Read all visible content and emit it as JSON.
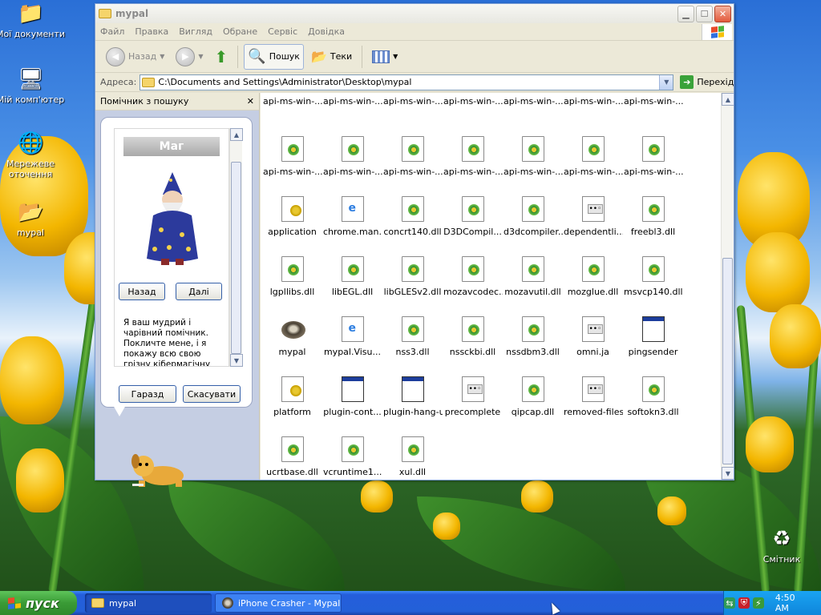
{
  "desktop": {
    "icons": [
      {
        "label": "Мої документи",
        "icon": "my-documents-icon"
      },
      {
        "label": "Мій комп'ютер",
        "icon": "my-computer-icon"
      },
      {
        "label": "Мережеве оточення",
        "icon": "network-places-icon"
      },
      {
        "label": "mypal",
        "icon": "folder-icon"
      },
      {
        "label": "Смітник",
        "icon": "recycle-bin-icon"
      }
    ]
  },
  "window": {
    "title": "mypal",
    "menu": [
      "Файл",
      "Правка",
      "Вигляд",
      "Обране",
      "Сервіс",
      "Довідка"
    ],
    "toolbar": {
      "back": "Назад",
      "search": "Пошук",
      "folders": "Теки"
    },
    "address": {
      "label": "Адреса:",
      "value": "C:\\Documents and Settings\\Administrator\\Desktop\\mypal",
      "go": "Перехід"
    }
  },
  "search_pane": {
    "title": "Помічник з пошуку",
    "character_name": "Маг",
    "back_button": "Назад",
    "next_button": "Далі",
    "description": "Я ваш мудрий і чарівний помічник. Покличте мене, і я покажу всю свою грізну кібермагічну силу",
    "ok_button": "Гаразд",
    "cancel_button": "Скасувати"
  },
  "files": {
    "top_row": [
      "api-ms-win-...",
      "api-ms-win-...",
      "api-ms-win-...",
      "api-ms-win-...",
      "api-ms-win-...",
      "api-ms-win-...",
      "api-ms-win-..."
    ],
    "rows": [
      [
        {
          "name": "api-ms-win-...",
          "type": "dll"
        },
        {
          "name": "api-ms-win-...",
          "type": "dll"
        },
        {
          "name": "api-ms-win-...",
          "type": "dll"
        },
        {
          "name": "api-ms-win-...",
          "type": "dll"
        },
        {
          "name": "api-ms-win-...",
          "type": "dll"
        },
        {
          "name": "api-ms-win-...",
          "type": "dll"
        },
        {
          "name": "api-ms-win-...",
          "type": "dll"
        }
      ],
      [
        {
          "name": "application",
          "type": "cfg"
        },
        {
          "name": "chrome.man...",
          "type": "man"
        },
        {
          "name": "concrt140.dll",
          "type": "dll"
        },
        {
          "name": "D3DCompil...",
          "type": "dll"
        },
        {
          "name": "d3dcompiler...",
          "type": "dll"
        },
        {
          "name": "dependentli...",
          "type": "ja"
        },
        {
          "name": "freebl3.dll",
          "type": "dll"
        }
      ],
      [
        {
          "name": "lgpllibs.dll",
          "type": "dll"
        },
        {
          "name": "libEGL.dll",
          "type": "dll"
        },
        {
          "name": "libGLESv2.dll",
          "type": "dll"
        },
        {
          "name": "mozavcodec...",
          "type": "dll"
        },
        {
          "name": "mozavutil.dll",
          "type": "dll"
        },
        {
          "name": "mozglue.dll",
          "type": "dll"
        },
        {
          "name": "msvcp140.dll",
          "type": "dll"
        }
      ],
      [
        {
          "name": "mypal",
          "type": "raccoon"
        },
        {
          "name": "mypal.Visu...",
          "type": "man"
        },
        {
          "name": "nss3.dll",
          "type": "dll"
        },
        {
          "name": "nssckbi.dll",
          "type": "dll"
        },
        {
          "name": "nssdbm3.dll",
          "type": "dll"
        },
        {
          "name": "omni.ja",
          "type": "ja"
        },
        {
          "name": "pingsender",
          "type": "appw"
        }
      ],
      [
        {
          "name": "platform",
          "type": "cfg"
        },
        {
          "name": "plugin-cont...",
          "type": "appw"
        },
        {
          "name": "plugin-hang-ui",
          "type": "appw"
        },
        {
          "name": "precomplete",
          "type": "ja"
        },
        {
          "name": "qipcap.dll",
          "type": "dll"
        },
        {
          "name": "removed-files",
          "type": "ja"
        },
        {
          "name": "softokn3.dll",
          "type": "dll"
        }
      ],
      [
        {
          "name": "ucrtbase.dll",
          "type": "dll"
        },
        {
          "name": "vcruntime1...",
          "type": "dll"
        },
        {
          "name": "xul.dll",
          "type": "dll"
        }
      ]
    ]
  },
  "taskbar": {
    "start": "пуск",
    "tasks": [
      "mypal",
      "iPhone Crasher - Mypal"
    ],
    "clock": "4:50 AM"
  }
}
